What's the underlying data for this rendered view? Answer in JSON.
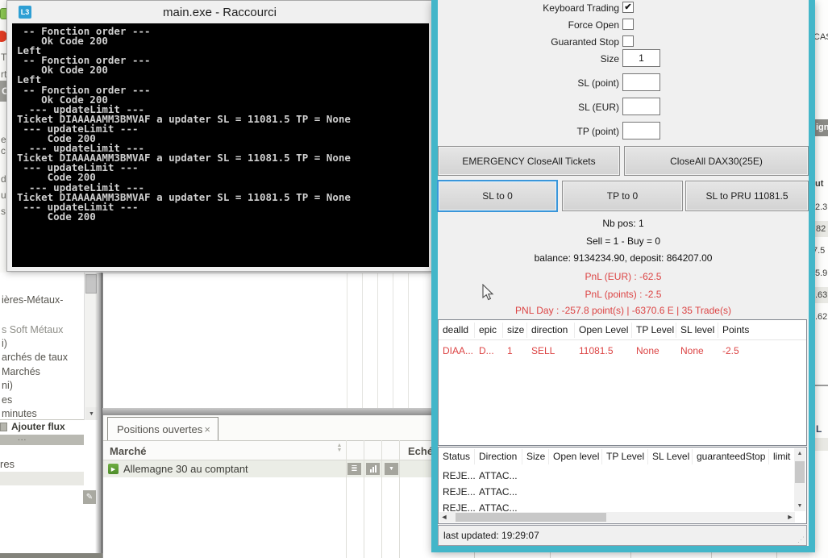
{
  "console": {
    "icon": "L3",
    "title": "main.exe - Raccourci",
    "lines": [
      " -- Fonction order ---",
      "    Ok Code 200",
      "Left",
      " -- Fonction order ---",
      "    Ok Code 200",
      "Left",
      " -- Fonction order ---",
      "    Ok Code 200",
      "  --- updateLimit ---",
      "Ticket DIAAAAAMM3BMVAF a updater SL = 11081.5 TP = None",
      " --- updateLimit ---",
      "     Code 200",
      "  --- updateLimit ---",
      "Ticket DIAAAAAMM3BMVAF a updater SL = 11081.5 TP = None",
      " --- updateLimit ---",
      "     Code 200",
      "  --- updateLimit ---",
      "Ticket DIAAAAAMM3BMVAF a updater SL = 11081.5 TP = None",
      " --- updateLimit ---",
      "     Code 200"
    ]
  },
  "panel": {
    "checkboxes": [
      {
        "label": "Keyboard Trading",
        "checked": true,
        "mark": "✔"
      },
      {
        "label": "Force Open",
        "checked": false,
        "mark": ""
      },
      {
        "label": "Guaranted Stop",
        "checked": false,
        "mark": ""
      }
    ],
    "fields": [
      {
        "label": "Size",
        "value": "1"
      },
      {
        "label": "SL (point)",
        "value": ""
      },
      {
        "label": "SL (EUR)",
        "value": ""
      },
      {
        "label": "TP (point)",
        "value": ""
      }
    ],
    "buttons": {
      "emergency": "EMERGENCY CloseAll Tickets",
      "closeall": "CloseAll DAX30(25E)",
      "sl0": "SL to 0",
      "tp0": "TP to 0",
      "slpru": "SL to PRU 11081.5"
    },
    "summary": {
      "nb_pos": "Nb pos: 1",
      "sell_buy": "Sell = 1 - Buy = 0",
      "balance": "balance: 9134234.90, deposit: 864207.00",
      "pnl_eur": "PnL (EUR) : -62.5",
      "pnl_points": "PnL (points) : -2.5",
      "pnl_day": "PNL Day : -257.8 point(s) | -6370.6 E | 35 Trade(s)"
    },
    "positions_table": {
      "headers": [
        "dealld",
        "epic",
        "size",
        "direction",
        "Open Level",
        "TP Level",
        "SL level",
        "Points"
      ],
      "row": [
        "DIAA...",
        "D...",
        "1",
        "SELL",
        "11081.5",
        "None",
        "None",
        "-2.5"
      ]
    },
    "orders_table": {
      "headers": [
        "Status",
        "Direction",
        "Size",
        "Open level",
        "TP Level",
        "SL Level",
        "guaranteedStop",
        "limit"
      ],
      "rows": [
        [
          "REJE...",
          "ATTAC..."
        ],
        [
          "REJE...",
          "ATTAC..."
        ],
        [
          "REJE...",
          "ATTAC..."
        ]
      ]
    },
    "status_bar": "last updated: 19:29:07"
  },
  "background": {
    "sidebar": {
      "items": [
        "ières-Métaux-",
        "s Soft Métaux",
        "i)",
        "archés de taux",
        "Marchés",
        "ni)",
        "es",
        "minutes"
      ],
      "ajouter_flux": "Ajouter flux",
      "dots": "...",
      "res": "res"
    },
    "positions_panel": {
      "tab": "Positions ouvertes",
      "marche": "Marché",
      "echeance": "Echéa",
      "row": "Allemagne 30 au comptant"
    },
    "right_strip": {
      "cas": "CAS",
      "ign": "ign",
      "ut": "ut",
      "v1": "2.3",
      "v2": "82",
      "v3": "7.5",
      "v4": "5.9",
      "v5": ".63",
      "v6": ".62",
      "l": "L"
    },
    "left_strip": {
      "t": "T",
      "rt": "rt",
      "c": "C",
      "ec": "e c",
      "de": "de",
      "ur": "ur",
      "s": "s"
    }
  },
  "icons": {
    "check": "✔",
    "close": "×",
    "sort_up": "▲",
    "sort_down": "▼",
    "play": "▶",
    "list": "≣",
    "dropdown": "▼",
    "pencil": "✎",
    "scroll_up": "▲",
    "scroll_down": "▼",
    "scroll_left": "◄",
    "scroll_right": "►",
    "grip": "⋰"
  },
  "colors": {
    "teal": "#43b6c9",
    "red": "#dc4444"
  }
}
